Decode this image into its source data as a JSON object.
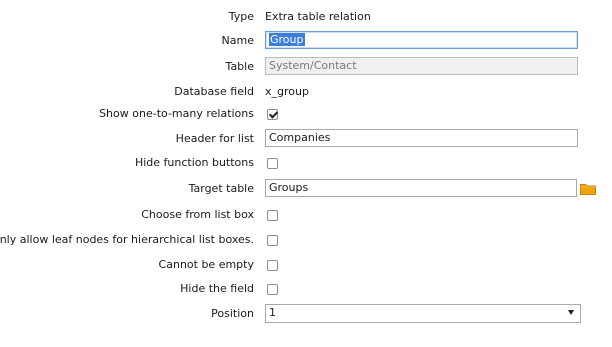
{
  "fields": {
    "type": {
      "label": "Type",
      "value": "Extra table relation"
    },
    "name": {
      "label": "Name",
      "value": "Group"
    },
    "table": {
      "label": "Table",
      "value": "System/Contact"
    },
    "database_field": {
      "label": "Database field",
      "value": "x_group"
    },
    "show_one_to_many": {
      "label": "Show one-to-many relations",
      "checked": true
    },
    "header_for_list": {
      "label": "Header for list",
      "value": "Companies"
    },
    "hide_function_buttons": {
      "label": "Hide function buttons",
      "checked": false
    },
    "target_table": {
      "label": "Target table",
      "value": "Groups",
      "icon": "folder-icon"
    },
    "choose_from_list_box": {
      "label": "Choose from list box",
      "checked": false
    },
    "only_leaf_nodes": {
      "label": "Only allow leaf nodes for hierarchical list boxes.",
      "checked": false
    },
    "cannot_be_empty": {
      "label": "Cannot be empty",
      "checked": false
    },
    "hide_the_field": {
      "label": "Hide the field",
      "checked": false
    },
    "position": {
      "label": "Position",
      "value": "1"
    }
  },
  "colors": {
    "selection": "#3d7fd6",
    "folder": "#f0a30a",
    "focus_border": "#6b9bd1"
  }
}
